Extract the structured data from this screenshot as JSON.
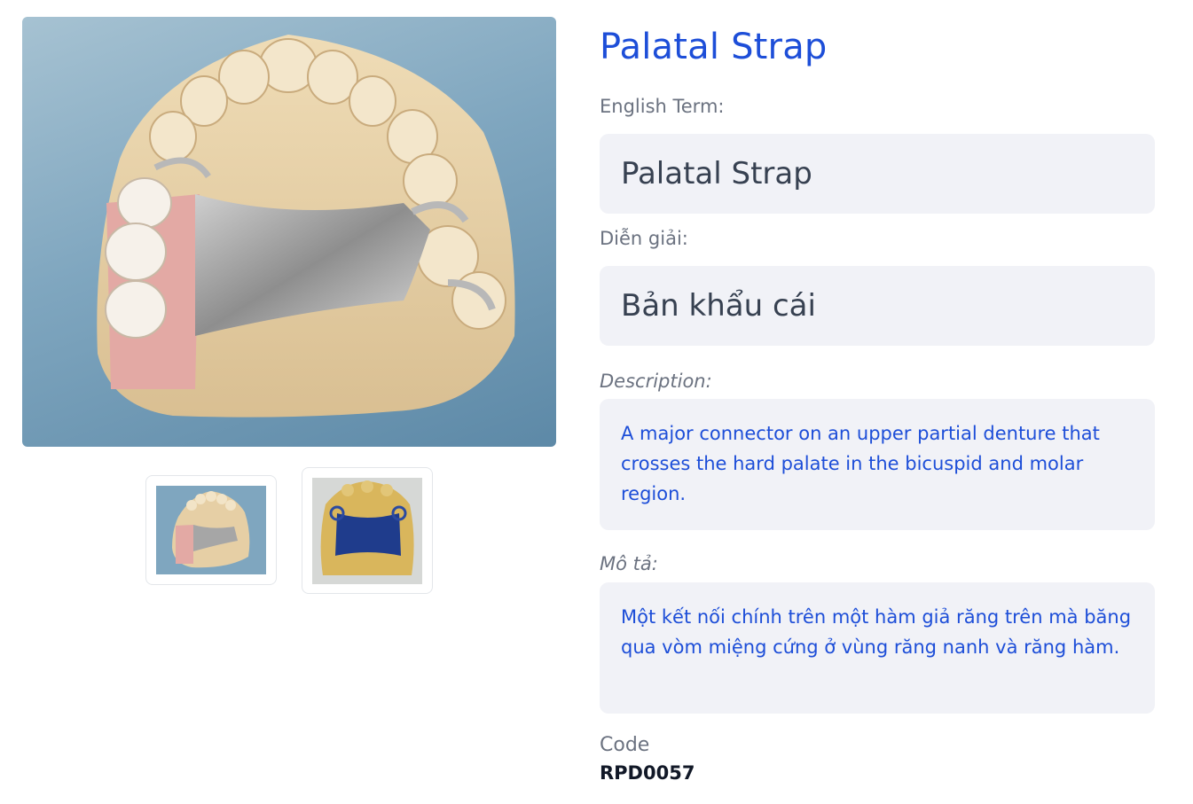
{
  "product": {
    "title": "Palatal Strap",
    "english_term_label": "English Term:",
    "english_term": "Palatal Strap",
    "vietnamese_label": "Diễn giải:",
    "vietnamese_term": "Bản khẩu cái",
    "description_label": "Description:",
    "description": "A major connector on an upper partial denture that crosses the hard palate in the bicuspid and molar region.",
    "vn_description_label": "Mô tả:",
    "vn_description": "Một kết nối chính trên một hàm giả răng trên mà băng qua vòm miệng cứng ở vùng răng nanh và răng hàm.",
    "code_label": "Code",
    "code": "RPD0057"
  },
  "gallery": {
    "main_image_icon": "dental-model-photo-icon",
    "thumbnails": [
      {
        "icon": "palatal-strap-metal-thumbnail-icon"
      },
      {
        "icon": "palatal-strap-wax-pattern-thumbnail-icon"
      }
    ]
  },
  "colors": {
    "accent": "#1d4ed8",
    "box_background": "#f1f2f7",
    "label": "#6b7280"
  }
}
